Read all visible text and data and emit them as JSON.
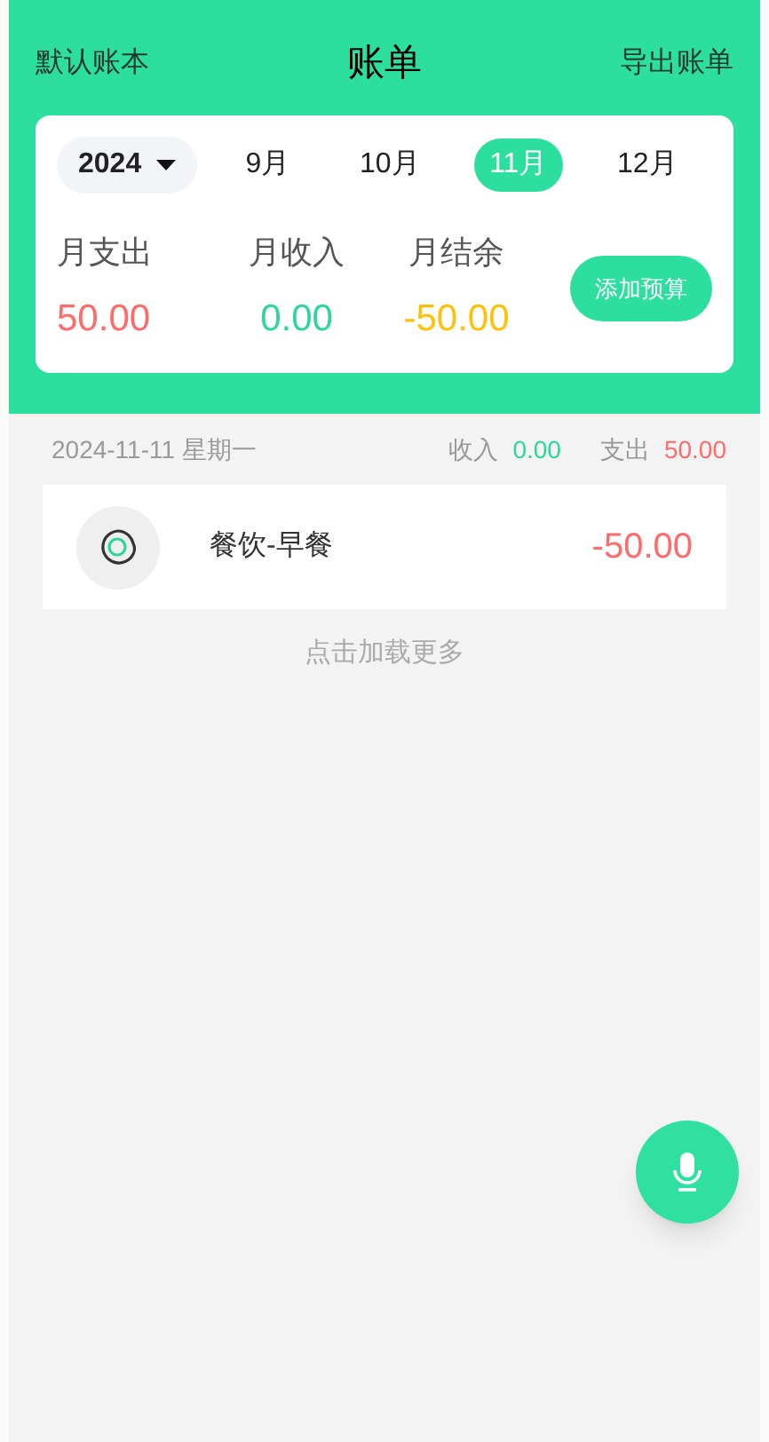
{
  "header": {
    "left": "默认账本",
    "title": "账单",
    "right": "导出账单"
  },
  "year_picker": {
    "value": "2024"
  },
  "months": [
    {
      "label": "9月",
      "selected": false
    },
    {
      "label": "10月",
      "selected": false
    },
    {
      "label": "11月",
      "selected": true
    },
    {
      "label": "12月",
      "selected": false
    }
  ],
  "summary": [
    {
      "label": "月支出",
      "value": "50.00",
      "color": "#ff6b6b"
    },
    {
      "label": "月收入",
      "value": "0.00",
      "color": "#2dd69b"
    },
    {
      "label": "月结余",
      "value": "-50.00",
      "color": "#ffc107"
    }
  ],
  "budget_button": "添加预算",
  "days": [
    {
      "date": "2024-11-11 星期一",
      "income_label": "收入",
      "income": "0.00",
      "expense_label": "支出",
      "expense": "50.00",
      "entries": [
        {
          "category": "餐饮-早餐",
          "amount": "-50.00"
        }
      ]
    }
  ],
  "load_more": "点击加载更多"
}
